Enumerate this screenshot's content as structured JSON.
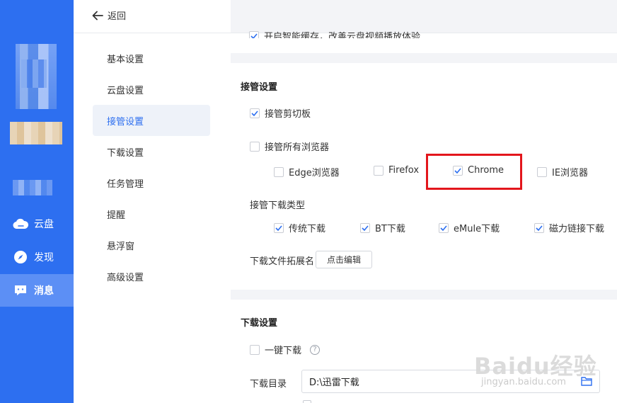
{
  "rail": {
    "items": [
      {
        "label": "云盘",
        "icon": "cloud-icon"
      },
      {
        "label": "发现",
        "icon": "compass-icon"
      },
      {
        "label": "消息",
        "icon": "message-icon",
        "active": true
      }
    ]
  },
  "header": {
    "back_label": "返回"
  },
  "settings_nav": {
    "items": [
      {
        "label": "基本设置"
      },
      {
        "label": "云盘设置"
      },
      {
        "label": "接管设置",
        "active": true
      },
      {
        "label": "下载设置"
      },
      {
        "label": "任务管理"
      },
      {
        "label": "提醒"
      },
      {
        "label": "悬浮窗"
      },
      {
        "label": "高级设置"
      }
    ]
  },
  "cutoff_row": {
    "label": "开启智能缓存，改善云盘视频播放体验",
    "checked": true
  },
  "takeover": {
    "title": "接管设置",
    "clipboard": {
      "label": "接管剪切板",
      "checked": true
    },
    "all_browsers": {
      "label": "接管所有浏览器",
      "checked": false
    },
    "browsers": [
      {
        "label": "Edge浏览器",
        "checked": false
      },
      {
        "label": "Firefox",
        "checked": false
      },
      {
        "label": "Chrome",
        "checked": true
      },
      {
        "label": "IE浏览器",
        "checked": false
      }
    ],
    "download_types_label": "接管下载类型",
    "download_types": [
      {
        "label": "传统下载",
        "checked": true
      },
      {
        "label": "BT下载",
        "checked": true
      },
      {
        "label": "eMule下载",
        "checked": true
      },
      {
        "label": "磁力链接下载",
        "checked": true
      }
    ],
    "extension_label": "下载文件拓展名",
    "edit_button": "点击编辑"
  },
  "download": {
    "title": "下载设置",
    "one_click": {
      "label": "一键下载",
      "checked": false
    },
    "dir_label": "下载目录",
    "dir_value": "D:\\迅雷下载"
  },
  "watermark": {
    "logo": "Baidu经验",
    "url": "jingyan.baidu.com"
  },
  "colors": {
    "accent": "#2d6ff0",
    "highlight": "#e3161c"
  }
}
